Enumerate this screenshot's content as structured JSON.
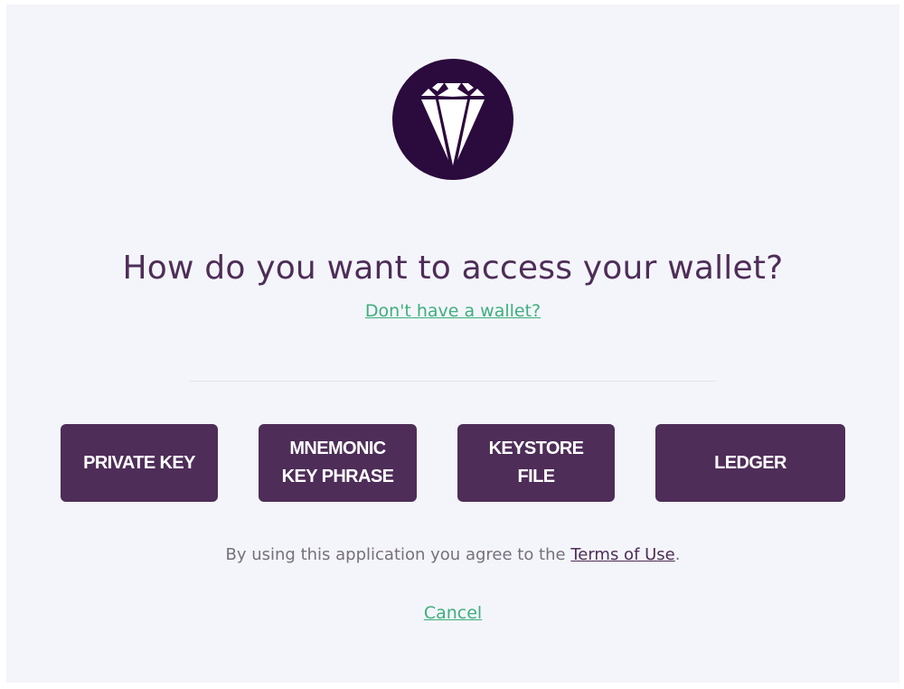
{
  "logo": {
    "icon": "diamond-icon",
    "background": "#2b0a3d"
  },
  "heading": "How do you want to access your wallet?",
  "no_wallet_link": "Don't have a wallet?",
  "access_methods": [
    {
      "line1": "PRIVATE KEY",
      "line2": ""
    },
    {
      "line1": "MNEMONIC",
      "line2": "KEY PHRASE"
    },
    {
      "line1": "KEYSTORE",
      "line2": "FILE"
    },
    {
      "line1": "LEDGER",
      "line2": ""
    }
  ],
  "terms": {
    "prefix": "By using this application you agree to the ",
    "link": "Terms of Use",
    "suffix": "."
  },
  "cancel": "Cancel",
  "colors": {
    "primary": "#4e2d58",
    "logo_bg": "#2b0a3d",
    "link_green": "#3fae7e",
    "page_bg": "#f4f5fa",
    "muted_text": "#76707c"
  }
}
